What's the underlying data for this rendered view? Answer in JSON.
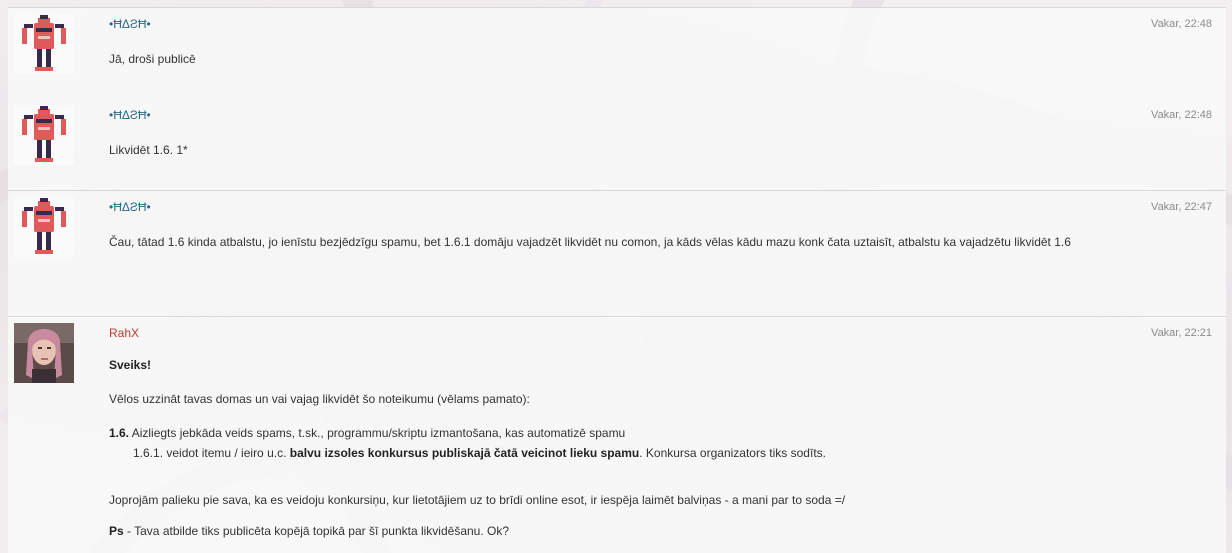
{
  "posts": [
    {
      "author": "•ĦΔƧĦ•",
      "time": "Vakar, 22:48",
      "text": "Jā, droši publicē"
    },
    {
      "author": "•ĦΔƧĦ•",
      "time": "Vakar, 22:48",
      "text": "Likvidēt 1.6. 1*"
    },
    {
      "author": "•ĦΔƧĦ•",
      "time": "Vakar, 22:47",
      "text": "Čau, tātad 1.6 kinda atbalstu, jo ienīstu bezjēdzīgu spamu, bet 1.6.1 domāju vajadzēt likvidēt nu comon, ja kāds vēlas kādu mazu konk čata uztaisīt, atbalstu ka vajadzētu likvidēt 1.6"
    },
    {
      "author": "RahX",
      "time": "Vakar, 22:21",
      "greeting": "Sveiks!",
      "intro": "Vēlos uzzināt tavas domas un vai vajag likvidēt šo noteikumu (vēlams pamato):",
      "rule_num": "1.6.",
      "rule_text": "Aizliegts jebkāda veids spams, t.sk., programmu/skriptu izmantošana, kas automatizē spamu",
      "sub_pre": "1.6.1. veidot itemu / ieiro u.c.",
      "sub_bold": "balvu izsoles konkursus publiskajā čatā  veicinot lieku spamu",
      "sub_post": ". Konkursa organizators tiks sodīts.",
      "opinion": "Joprojām palieku pie sava, ka es veidoju konkursiņu, kur lietotājiem uz to brīdi online esot, ir iespēja laimēt balviņas - a mani par to soda =/",
      "ps_label": "Ps",
      "ps_text": " - Tava atbilde tiks publicēta kopējā topikā par šī punkta likvidēšanu. Ok?"
    }
  ]
}
